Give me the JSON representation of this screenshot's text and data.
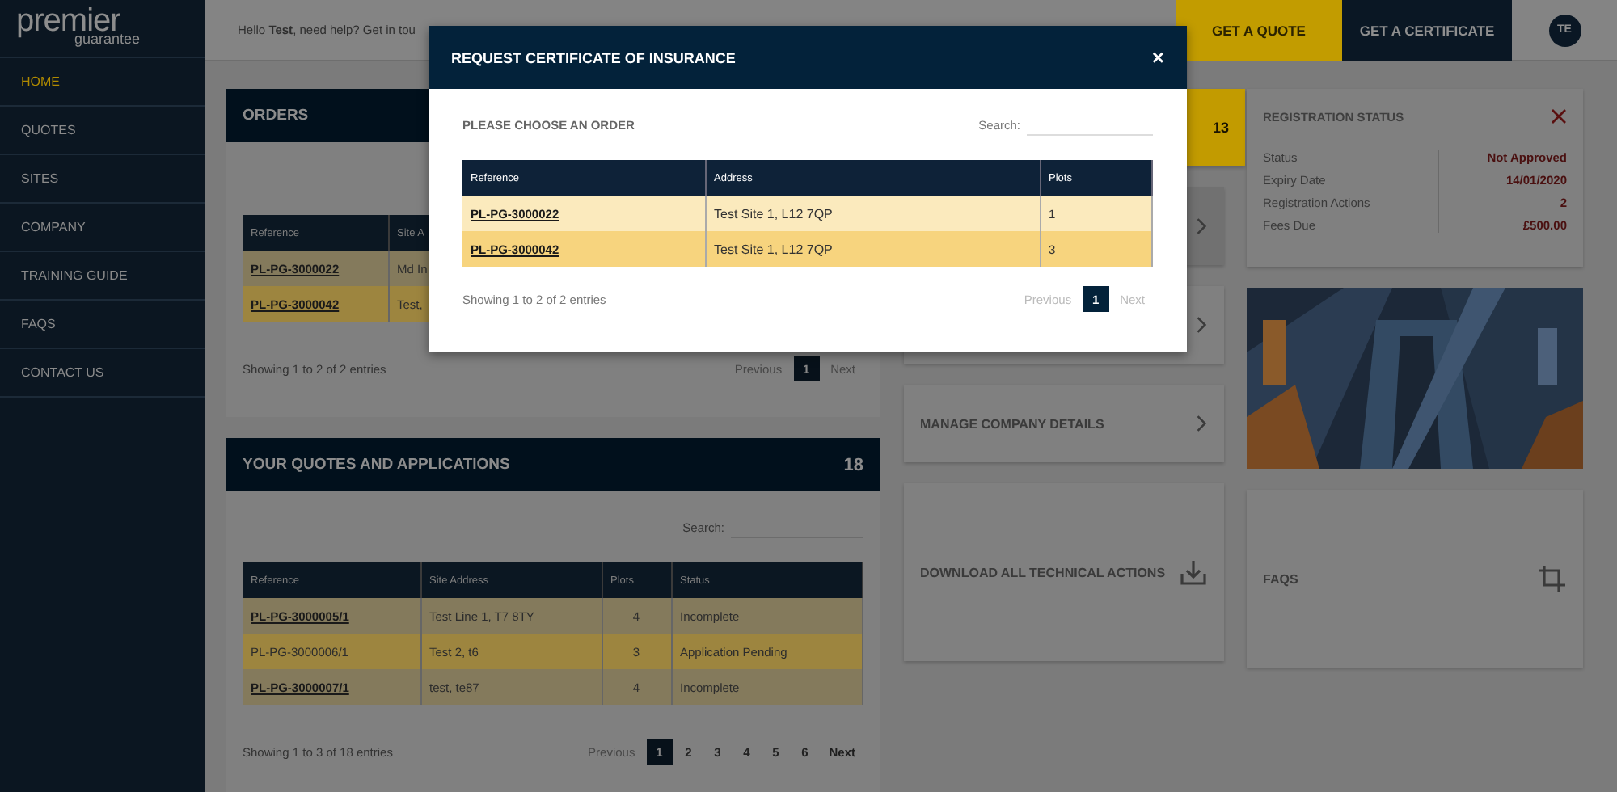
{
  "sidebar": {
    "logo": {
      "name": "premier",
      "tagline": "guarantee"
    },
    "items": [
      {
        "label": "HOME",
        "selected": true
      },
      {
        "label": "QUOTES",
        "selected": false
      },
      {
        "label": "SITES",
        "selected": false
      },
      {
        "label": "COMPANY",
        "selected": false
      },
      {
        "label": "TRAINING GUIDE",
        "selected": false
      },
      {
        "label": "FAQS",
        "selected": false
      },
      {
        "label": "CONTACT US",
        "selected": false
      }
    ]
  },
  "header": {
    "greeting": "Hello **Test**, need help? Get in tou",
    "buttons": [
      {
        "label": "GET A QUOTE",
        "kind": "quote"
      },
      {
        "label": "GET A CERTIFICATE",
        "kind": "certificate"
      }
    ],
    "avatar": "TE"
  },
  "orders": {
    "title": "ORDERS",
    "columns": [
      "Reference",
      "Site A"
    ],
    "rows": [
      {
        "reference": "PL-PG-3000022",
        "address": "Md In"
      },
      {
        "reference": "PL-PG-3000042",
        "address": "Test,"
      }
    ],
    "info": "Showing 1 to 2 of 2 entries",
    "pagination": {
      "previous": {
        "label": "Previous",
        "disabled": true
      },
      "pages": [
        {
          "label": "1",
          "selected": true
        }
      ],
      "next": {
        "label": "Next",
        "disabled": true
      }
    }
  },
  "quotes": {
    "title": "YOUR QUOTES AND APPLICATIONS",
    "count": "18",
    "search_label": "Search:",
    "columns": [
      "Reference",
      "Site Address",
      "Plots",
      "Status"
    ],
    "rows": [
      {
        "reference": "PL-PG-3000005/1",
        "linked": true,
        "address": "Test Line 1, T7 8TY",
        "plots": "4",
        "status": "Incomplete"
      },
      {
        "reference": "PL-PG-3000006/1",
        "linked": false,
        "address": "Test 2, t6",
        "plots": "3",
        "status": "Application Pending"
      },
      {
        "reference": "PL-PG-3000007/1",
        "linked": true,
        "address": "test, te87",
        "plots": "4",
        "status": "Incomplete"
      }
    ],
    "info": "Showing 1 to 3 of 18 entries",
    "pagination": {
      "previous": {
        "label": "Previous",
        "disabled": true
      },
      "pages": [
        {
          "label": "1",
          "selected": true
        },
        {
          "label": "2",
          "selected": false
        },
        {
          "label": "3",
          "selected": false
        },
        {
          "label": "4",
          "selected": false
        },
        {
          "label": "5",
          "selected": false
        },
        {
          "label": "6",
          "selected": false
        }
      ],
      "next": {
        "label": "Next",
        "disabled": false
      }
    }
  },
  "tiles": [
    {
      "kind": "count",
      "count": "13"
    },
    {
      "kind": "link"
    },
    {
      "kind": "link"
    },
    {
      "kind": "link",
      "label": "MANAGE COMPANY DETAILS"
    },
    {
      "kind": "download",
      "label": "DOWNLOAD ALL TECHNICAL ACTIONS"
    }
  ],
  "registration": {
    "title": "REGISTRATION STATUS",
    "rows": [
      {
        "label": "Status",
        "value": "Not Approved"
      },
      {
        "label": "Expiry Date",
        "value": "14/01/2020"
      },
      {
        "label": "Registration Actions",
        "value": "2"
      },
      {
        "label": "Fees Due",
        "value": "£500.00"
      }
    ]
  },
  "faqs": {
    "label": "FAQS"
  },
  "modal": {
    "title": "REQUEST CERTIFICATE OF INSURANCE",
    "close": "×",
    "prompt": "PLEASE CHOOSE AN ORDER",
    "search_label": "Search:",
    "columns": [
      "Reference",
      "Address",
      "Plots"
    ],
    "rows": [
      {
        "reference": "PL-PG-3000022",
        "address": "Test Site 1, L12 7QP",
        "plots": "1"
      },
      {
        "reference": "PL-PG-3000042",
        "address": "Test Site 1, L12 7QP",
        "plots": "3"
      }
    ],
    "info": "Showing 1 to 2 of 2 entries",
    "pagination": {
      "previous": {
        "label": "Previous",
        "disabled": true
      },
      "pages": [
        {
          "label": "1",
          "selected": true
        }
      ],
      "next": {
        "label": "Next",
        "disabled": true
      }
    }
  }
}
